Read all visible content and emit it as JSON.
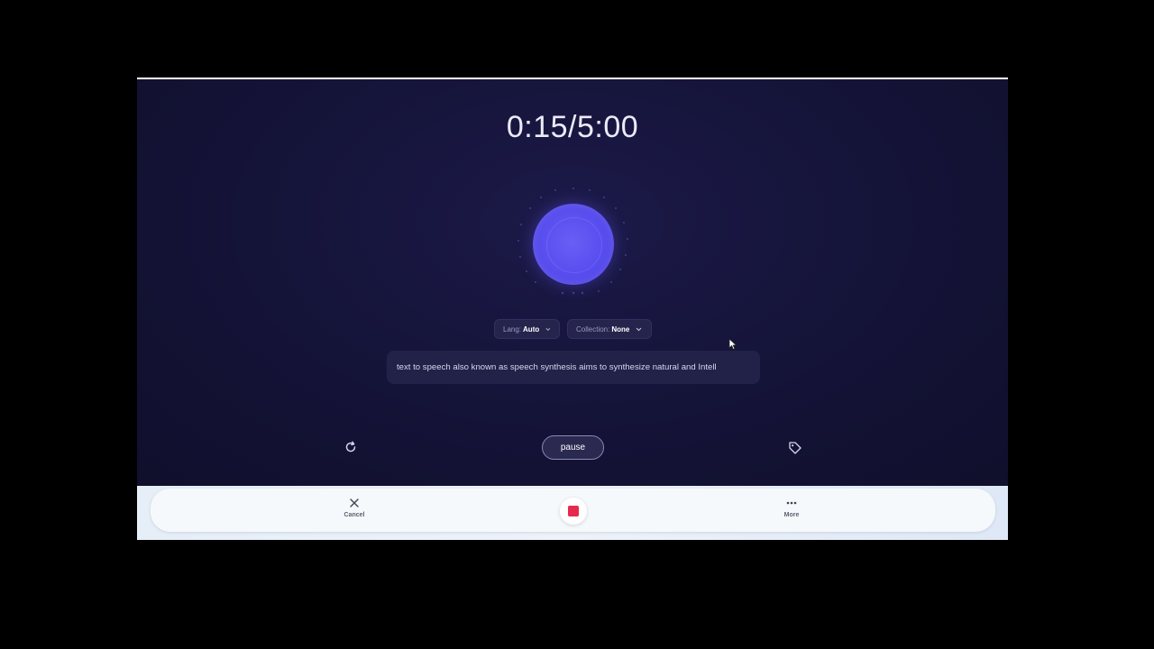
{
  "recorder": {
    "timer": "0:15/5:00",
    "lang_chip": {
      "label": "Lang:",
      "value": "Auto"
    },
    "collection_chip": {
      "label": "Collection:",
      "value": "None"
    },
    "transcript": "text to speech also known as speech synthesis aims to synthesize natural and Intell",
    "pause_label": "pause",
    "refresh_icon": "refresh-icon",
    "tag_icon": "tag-icon"
  },
  "bottom_bar": {
    "cancel_label": "Cancel",
    "more_label": "More",
    "stop_icon": "stop-icon"
  },
  "colors": {
    "background": "#15143a",
    "orb": "#5b50f0",
    "stop": "#e62a4e",
    "bottom_bar": "#f6f9fb"
  }
}
